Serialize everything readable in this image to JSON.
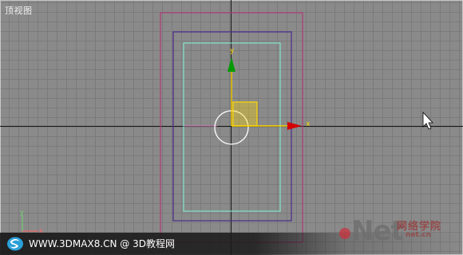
{
  "viewport": {
    "label": "顶视图",
    "active_axis_color": "#ff0000",
    "grid_color": "#7b7b7b",
    "background_color": "#8a8a8a"
  },
  "gizmo": {
    "y_label": "y",
    "x_label": "x",
    "x_axis_color": "#d40000",
    "y_axis_color": "#00a000",
    "plane_color": "#ffd700"
  },
  "corner_triad": {
    "y_label": "y",
    "x_label": "x"
  },
  "watermark": {
    "text": "WWW.3DMAX8.CN @ 3D教程网",
    "icon": "3dmax8-swirl-logo-icon"
  },
  "site_logo": {
    "word": "Net",
    "chinese_text": "网络学院",
    "sub_text": "net.cn"
  }
}
